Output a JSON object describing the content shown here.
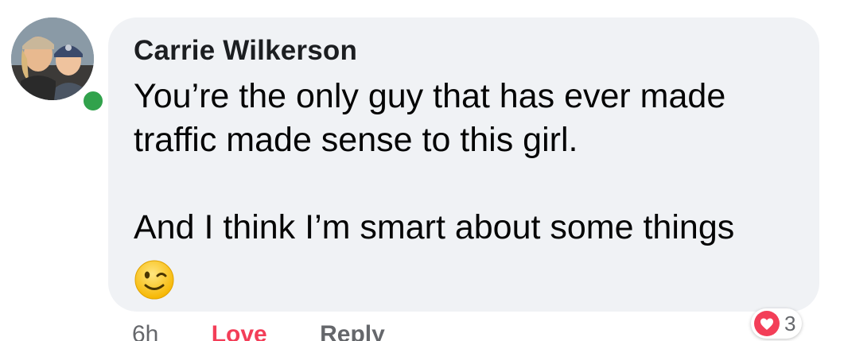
{
  "comment": {
    "author": "Carrie Wilkerson",
    "lines": [
      "You’re the only guy that has ever made",
      "traffic made sense to this girl."
    ],
    "lines2": [
      "And I think I’m smart about some things"
    ],
    "emoji": "winking-face-emoji",
    "online": true
  },
  "actions": {
    "time": "6h",
    "love_label": "Love",
    "reply_label": "Reply"
  },
  "reaction": {
    "icon": "love-heart-icon",
    "count": "3"
  },
  "colors": {
    "bubble": "#f0f2f5",
    "online": "#31a24c",
    "love": "#f33e58",
    "secondary_text": "#65676b"
  }
}
